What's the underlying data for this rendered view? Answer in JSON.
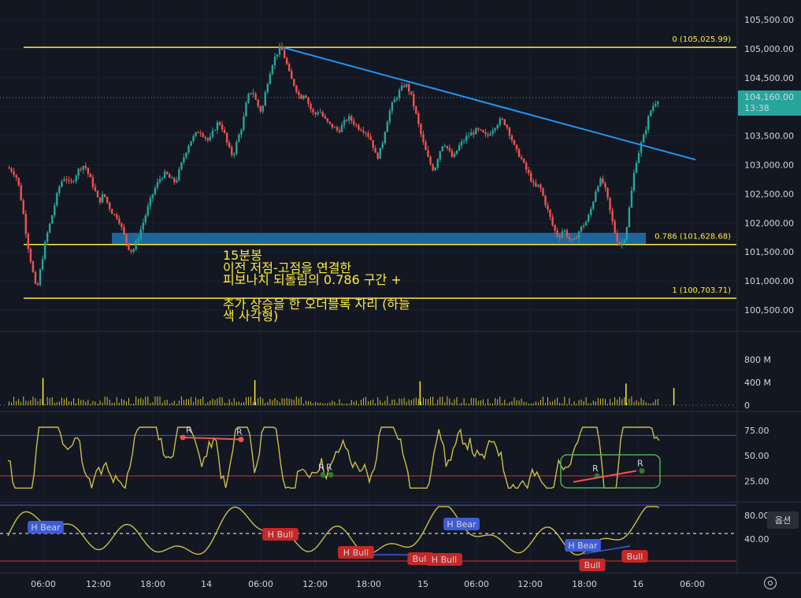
{
  "chart_data": [
    {
      "type": "candlestick",
      "interval_label": "15분봉",
      "price_axis_ticks": [
        "105,500.00",
        "105,000.00",
        "104,500.00",
        "104,000.00",
        "103,500.00",
        "103,000.00",
        "102,500.00",
        "102,000.00",
        "101,500.00",
        "101,000.00",
        "100,500.00"
      ],
      "price_axis_values": [
        105500,
        105000,
        104500,
        104000,
        103500,
        103000,
        102500,
        102000,
        101500,
        101000,
        100500
      ],
      "ylim": [
        100300,
        105800
      ],
      "time_axis_ticks": [
        "06:00",
        "12:00",
        "18:00",
        "14",
        "06:00",
        "12:00",
        "18:00",
        "15",
        "06:00",
        "12:00",
        "18:00",
        "16",
        "06:00"
      ],
      "price_path": [
        [
          0,
          102950
        ],
        [
          4,
          102900
        ],
        [
          8,
          102750
        ],
        [
          12,
          102300
        ],
        [
          16,
          101700
        ],
        [
          20,
          101250
        ],
        [
          24,
          100800
        ],
        [
          28,
          101300
        ],
        [
          32,
          101750
        ],
        [
          36,
          102050
        ],
        [
          40,
          102400
        ],
        [
          44,
          102700
        ],
        [
          48,
          102800
        ],
        [
          52,
          102650
        ],
        [
          56,
          102800
        ],
        [
          60,
          102950
        ],
        [
          64,
          103000
        ],
        [
          68,
          102800
        ],
        [
          72,
          102600
        ],
        [
          76,
          102350
        ],
        [
          80,
          102500
        ],
        [
          84,
          102300
        ],
        [
          88,
          102150
        ],
        [
          92,
          102100
        ],
        [
          96,
          101850
        ],
        [
          100,
          101600
        ],
        [
          104,
          101500
        ],
        [
          108,
          101700
        ],
        [
          112,
          101950
        ],
        [
          116,
          102200
        ],
        [
          120,
          102450
        ],
        [
          124,
          102650
        ],
        [
          128,
          102800
        ],
        [
          132,
          102850
        ],
        [
          136,
          102750
        ],
        [
          140,
          102700
        ],
        [
          144,
          102950
        ],
        [
          148,
          103200
        ],
        [
          152,
          103400
        ],
        [
          156,
          103500
        ],
        [
          160,
          103600
        ],
        [
          164,
          103500
        ],
        [
          168,
          103400
        ],
        [
          172,
          103600
        ],
        [
          176,
          103750
        ],
        [
          180,
          103600
        ],
        [
          184,
          103300
        ],
        [
          188,
          103150
        ],
        [
          192,
          103450
        ],
        [
          196,
          103700
        ],
        [
          200,
          104150
        ],
        [
          204,
          104300
        ],
        [
          208,
          104050
        ],
        [
          212,
          103900
        ],
        [
          216,
          104350
        ],
        [
          220,
          104700
        ],
        [
          224,
          104900
        ],
        [
          228,
          105030
        ],
        [
          232,
          104800
        ],
        [
          236,
          104500
        ],
        [
          240,
          104350
        ],
        [
          244,
          104150
        ],
        [
          248,
          104250
        ],
        [
          252,
          104000
        ],
        [
          256,
          103850
        ],
        [
          260,
          103950
        ],
        [
          264,
          103800
        ],
        [
          268,
          103700
        ],
        [
          272,
          103650
        ],
        [
          276,
          103580
        ],
        [
          280,
          103700
        ],
        [
          284,
          103820
        ],
        [
          288,
          103750
        ],
        [
          292,
          103650
        ],
        [
          296,
          103620
        ],
        [
          300,
          103550
        ],
        [
          304,
          103400
        ],
        [
          308,
          103100
        ],
        [
          312,
          103300
        ],
        [
          316,
          103700
        ],
        [
          320,
          104000
        ],
        [
          324,
          104150
        ],
        [
          328,
          104300
        ],
        [
          332,
          104400
        ],
        [
          336,
          104250
        ],
        [
          340,
          103950
        ],
        [
          344,
          103600
        ],
        [
          348,
          103300
        ],
        [
          352,
          103050
        ],
        [
          356,
          102900
        ],
        [
          360,
          103200
        ],
        [
          364,
          103400
        ],
        [
          368,
          103250
        ],
        [
          372,
          103100
        ],
        [
          376,
          103300
        ],
        [
          380,
          103400
        ],
        [
          384,
          103500
        ],
        [
          388,
          103550
        ],
        [
          392,
          103600
        ],
        [
          396,
          103550
        ],
        [
          400,
          103480
        ],
        [
          404,
          103600
        ],
        [
          408,
          103700
        ],
        [
          412,
          103780
        ],
        [
          416,
          103700
        ],
        [
          420,
          103500
        ],
        [
          424,
          103250
        ],
        [
          428,
          103150
        ],
        [
          432,
          102950
        ],
        [
          436,
          102800
        ],
        [
          440,
          102600
        ],
        [
          444,
          102650
        ],
        [
          448,
          102400
        ],
        [
          452,
          102150
        ],
        [
          456,
          101900
        ],
        [
          460,
          101750
        ],
        [
          464,
          101900
        ],
        [
          468,
          101750
        ],
        [
          472,
          101650
        ],
        [
          476,
          101820
        ],
        [
          480,
          101950
        ],
        [
          484,
          102050
        ],
        [
          488,
          102300
        ],
        [
          492,
          102650
        ],
        [
          496,
          102750
        ],
        [
          500,
          102500
        ],
        [
          504,
          102100
        ],
        [
          508,
          101750
        ],
        [
          512,
          101600
        ],
        [
          516,
          101800
        ],
        [
          520,
          102400
        ],
        [
          524,
          103000
        ],
        [
          528,
          103300
        ],
        [
          532,
          103550
        ],
        [
          536,
          103900
        ],
        [
          540,
          104060
        ],
        [
          544,
          104160
        ]
      ],
      "volume_axis_ticks": [
        "800 M",
        "400 M",
        "0"
      ],
      "volume_axis_values": [
        800,
        400,
        0
      ],
      "current_price_label": "104,160.00",
      "countdown_label": "13:38",
      "fib_levels": [
        {
          "label": "0 (105,025.99)",
          "price": 105025.99
        },
        {
          "label": "0.786 (101,628.68)",
          "price": 101628.68
        },
        {
          "label": "1 (100,703.71)",
          "price": 100703.71
        }
      ],
      "trendline": {
        "from": [
          228,
          105025
        ],
        "to": [
          564,
          103090
        ]
      },
      "order_block": {
        "from": 100,
        "to": 560,
        "low": 101628.68,
        "high": 101830
      },
      "colors": {
        "up": "#26a69a",
        "down": "#ef5350",
        "fib": "#ffeb3b",
        "trend": "#2196f3",
        "order_block": "#1e6fa8"
      }
    },
    {
      "type": "line",
      "name": "RSI",
      "axis_ticks": [
        "75.00",
        "50.00",
        "25.00"
      ],
      "axis_values": [
        75,
        50,
        25
      ],
      "ylim": [
        5,
        92
      ],
      "bands": [
        70,
        30
      ],
      "divergence_marks": [
        "R",
        "R",
        "R",
        "R",
        "R",
        "R"
      ]
    },
    {
      "type": "line",
      "name": "oscillator",
      "axis_ticks": [
        "80.00",
        "40.00"
      ],
      "axis_values": [
        80,
        40
      ],
      "ylim": [
        0,
        100
      ],
      "labels": [
        "H Bear",
        "H Bull",
        "H Bull",
        "Bull",
        "H Bull",
        "H Bear",
        "H Bear",
        "Bull",
        "Bull"
      ]
    }
  ],
  "annotation": {
    "line1": "15분봉",
    "line2": "이전 저점-고점을 연결한",
    "line3": "피보나치 되돌림의 0.786 구간 +",
    "line4": "추가 상승을 한 오더블록 자리 (하늘",
    "line5": "색 사각형)"
  },
  "ui": {
    "options_button": "옵션",
    "settings_icon": "gear-icon"
  }
}
